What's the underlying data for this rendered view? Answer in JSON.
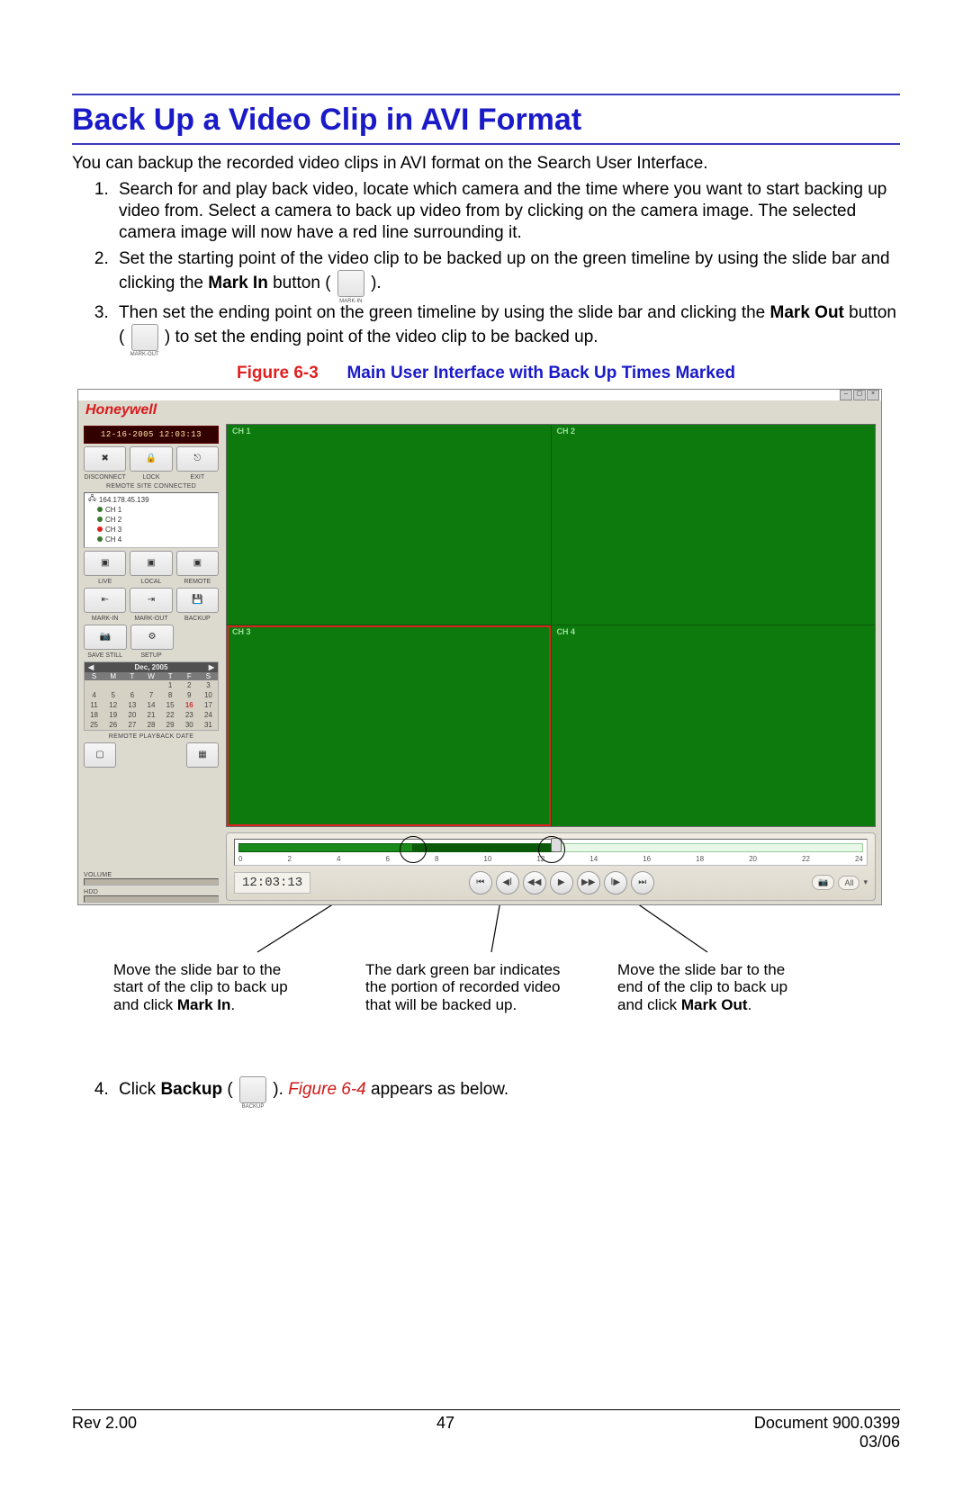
{
  "page": {
    "title": "Back Up a Video Clip in AVI Format",
    "intro": "You can backup the recorded video clips in AVI format on the Search User Interface."
  },
  "steps": {
    "s1": "Search for and play back video, locate which camera and the time where you want to start backing up video from. Select a camera to back up video from by clicking on the camera image. The selected camera image will now have a red line surrounding it.",
    "s2a": "Set the starting point of the video clip to be backed up on the green timeline by using the slide bar and clicking the ",
    "s2bold": "Mark In",
    "s2b": " button ( ",
    "s2c": " ).",
    "s3a": "Then set the ending point on the green timeline by using the slide bar and clicking the ",
    "s3bold": "Mark Out",
    "s3b": " button ( ",
    "s3c": " ) to set the ending point of the video clip to be backed up.",
    "s4a": "Click ",
    "s4bold": "Backup",
    "s4b": " ( ",
    "s4c": " ). ",
    "s4ref": "Figure 6-4",
    "s4d": " appears as below."
  },
  "fig_caption": {
    "label": "Figure 6-3",
    "text": "Main User Interface with Back Up Times Marked"
  },
  "app": {
    "brand": "Honeywell",
    "datetime": "12-16-2005 12:03:13",
    "buttons_top": {
      "b1": "DISCONNECT",
      "b2": "LOCK",
      "b3": "EXIT"
    },
    "remote_site_label": "REMOTE SITE CONNECTED",
    "remote_ip": "164.178.45.139",
    "channels": {
      "c1": "CH 1",
      "c2": "CH 2",
      "c3": "CH 3",
      "c4": "CH 4"
    },
    "mode_labels": {
      "live": "LIVE",
      "local": "LOCAL",
      "remote": "REMOTE"
    },
    "mark_labels": {
      "in": "MARK-IN",
      "out": "MARK-OUT",
      "backup": "BACKUP"
    },
    "action_labels": {
      "save": "SAVE STILL",
      "setup": "SETUP"
    },
    "calendar": {
      "month_label": "Dec, 2005",
      "dow": [
        "S",
        "M",
        "T",
        "W",
        "T",
        "F",
        "S"
      ],
      "days": [
        "",
        "",
        "",
        "",
        "1",
        "2",
        "3",
        "4",
        "5",
        "6",
        "7",
        "8",
        "9",
        "10",
        "11",
        "12",
        "13",
        "14",
        "15",
        "16",
        "17",
        "18",
        "19",
        "20",
        "21",
        "22",
        "23",
        "24",
        "25",
        "26",
        "27",
        "28",
        "29",
        "30",
        "31"
      ],
      "highlight": "16"
    },
    "remote_pb_label": "REMOTE PLAYBACK DATE",
    "volume_label": "VOLUME",
    "hdd_label": "HDD",
    "timecode": "12:03:13",
    "tick_labels": [
      "0",
      "2",
      "4",
      "6",
      "8",
      "10",
      "12",
      "14",
      "16",
      "18",
      "20",
      "22",
      "24"
    ],
    "cam_filter": "All"
  },
  "annotations": {
    "a1_l1": "Move the slide bar to the",
    "a1_l2": "start of the clip to back up",
    "a1_l3a": "and click ",
    "a1_l3b": "Mark In",
    "a1_l3c": ".",
    "a2_l1": "The dark green bar indicates",
    "a2_l2": "the portion of recorded video",
    "a2_l3": "that will be backed up.",
    "a3_l1": "Move the slide bar to the",
    "a3_l2": "end of the clip to back up",
    "a3_l3a": "and click ",
    "a3_l3b": "Mark Out",
    "a3_l3c": "."
  },
  "mini_icon_labels": {
    "markin": "MARK-IN",
    "markout": "MARK-OUT",
    "backup": "BACKUP"
  },
  "footer": {
    "rev": "Rev 2.00",
    "page": "47",
    "doc": "Document 900.0399",
    "date": "03/06"
  }
}
